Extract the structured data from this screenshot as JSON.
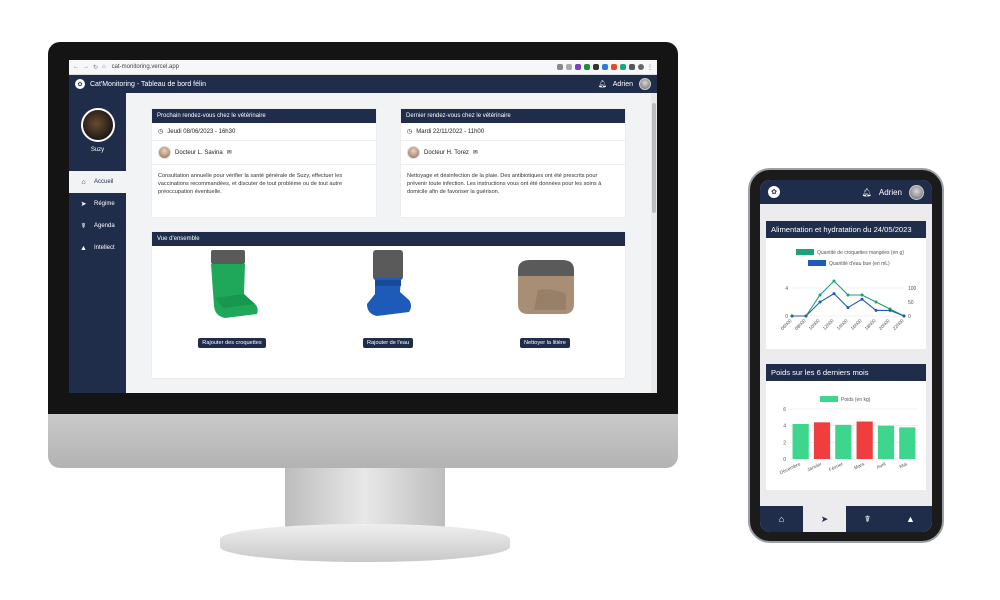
{
  "browser": {
    "url": "cat-monitoring.vercel.app"
  },
  "app": {
    "title": "Cat'Monitoring - Tableau de bord félin",
    "user": "Adrien"
  },
  "sidebar": {
    "cat_name": "Suzy",
    "items": [
      {
        "label": "Accueil",
        "icon": "home-icon",
        "glyph": "⌂"
      },
      {
        "label": "Régime",
        "icon": "fish-icon",
        "glyph": "➤"
      },
      {
        "label": "Agenda",
        "icon": "stethoscope-icon",
        "glyph": "☤"
      },
      {
        "label": "Intellect",
        "icon": "shapes-icon",
        "glyph": "▲"
      }
    ]
  },
  "next_appointment": {
    "title": "Prochain rendez-vous chez le vétérinaire",
    "date": "Jeudi 08/06/2023 - 16h30",
    "doctor": "Docteur L. Savina",
    "text": "Consultation annuelle pour vérifier la santé générale de Suzy, effectuer les vaccinations recommandées, et discuter de tout problème ou de tout autre préoccupation éventuelle."
  },
  "last_appointment": {
    "title": "Dernier rendez-vous chez le vétérinaire",
    "date": "Mardi 22/11/2022 - 11h00",
    "doctor": "Docteur H. Torez",
    "text": "Nettoyage et désinfection de la plaie. Des antibiotiques ont été prescrits pour prévenir toute infection. Les instructions vous ont été données pour les soins à domicile afin de favoriser la guérison."
  },
  "overview": {
    "title": "Vue d'ensemble",
    "buttons": [
      "Rajouter des croquettes",
      "Rajouter de l'eau",
      "Nettoyer la litière"
    ],
    "colors": {
      "food": "#1fa85a",
      "water": "#1e5bb8",
      "litter": "#a88e74",
      "cap": "#5a5a5a"
    }
  },
  "phone": {
    "user": "Adrien",
    "card1_title": "Alimentation et hydratation du 24/05/2023",
    "card2_title": "Poids sur les 6 derniers mois"
  },
  "chart_data": [
    {
      "type": "line",
      "title": "",
      "categories": [
        "06h00",
        "08h00",
        "10h00",
        "12h00",
        "14h00",
        "16h00",
        "18h00",
        "20h00",
        "22h00"
      ],
      "series": [
        {
          "name": "Quantité de croquettes mangées (en g)",
          "axis": "left",
          "color": "#1aa27a",
          "values": [
            0,
            0,
            3,
            5,
            3,
            3,
            2,
            1,
            0
          ]
        },
        {
          "name": "Quantité d'eau bue (en mL)",
          "axis": "right",
          "color": "#1e5bb8",
          "values": [
            0,
            0,
            50,
            80,
            30,
            60,
            20,
            20,
            0
          ]
        }
      ],
      "ylim_left": [
        0,
        4
      ],
      "yticks_left": [
        0,
        4
      ],
      "ylim_right": [
        0,
        100
      ],
      "yticks_right": [
        0,
        50,
        100
      ]
    },
    {
      "type": "bar",
      "title": "",
      "categories": [
        "Décembre",
        "Janvier",
        "Février",
        "Mars",
        "Avril",
        "Mai"
      ],
      "series": [
        {
          "name": "Poids (en kg)",
          "values": [
            4.2,
            4.4,
            4.1,
            4.5,
            4.0,
            3.8
          ]
        }
      ],
      "colors": [
        "#3dd68c",
        "#ef3e3e",
        "#3dd68c",
        "#ef3e3e",
        "#3dd68c",
        "#3dd68c"
      ],
      "ylim": [
        0,
        6
      ],
      "yticks": [
        0,
        2,
        4,
        6
      ]
    }
  ]
}
